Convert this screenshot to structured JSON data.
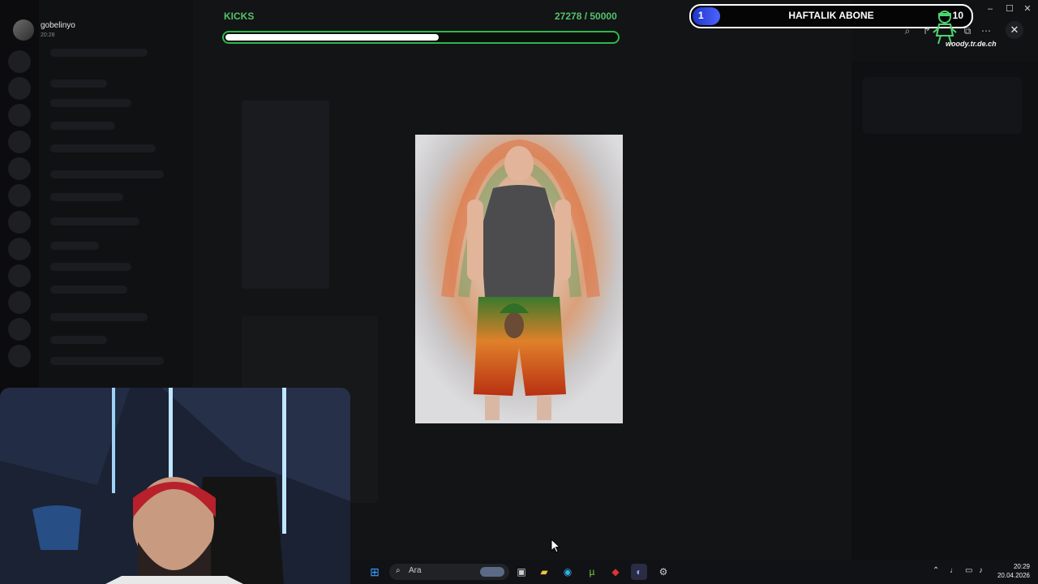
{
  "user": {
    "name": "gobelinyo",
    "time": "20:28"
  },
  "kicks": {
    "label": "KICKS",
    "count_text": "27278 / 50000",
    "current": 27278,
    "goal": 50000,
    "color": "#53c26a"
  },
  "weekly_sub": {
    "title": "HAFTALIK ABONE",
    "current": "1",
    "goal": "10",
    "progress": 0.1
  },
  "mascot_text": "woody.tr.de.ch",
  "window_controls": {
    "minimize": "–",
    "maximize": "☐",
    "close": "✕"
  },
  "viewer": {
    "close": "✕",
    "tools": [
      "zoom-icon",
      "forward-icon",
      "open-external-icon",
      "more-icon"
    ]
  },
  "taskbar": {
    "search_placeholder": "Ara",
    "icons": [
      "windows-start-icon",
      "search-icon",
      "task-view-icon",
      "file-explorer-icon",
      "edge-icon",
      "utorrent-icon",
      "game-icon",
      "discord-icon",
      "steam-icon"
    ],
    "tray": [
      "chevron-up-icon",
      "microphone-icon",
      "network-icon",
      "volume-icon"
    ],
    "clock_time": "20:29",
    "clock_date": "20.04.2026"
  },
  "colors": {
    "accent_green": "#2fb74f",
    "accent_blue": "#3b53ef",
    "taskbar": "#111216"
  }
}
